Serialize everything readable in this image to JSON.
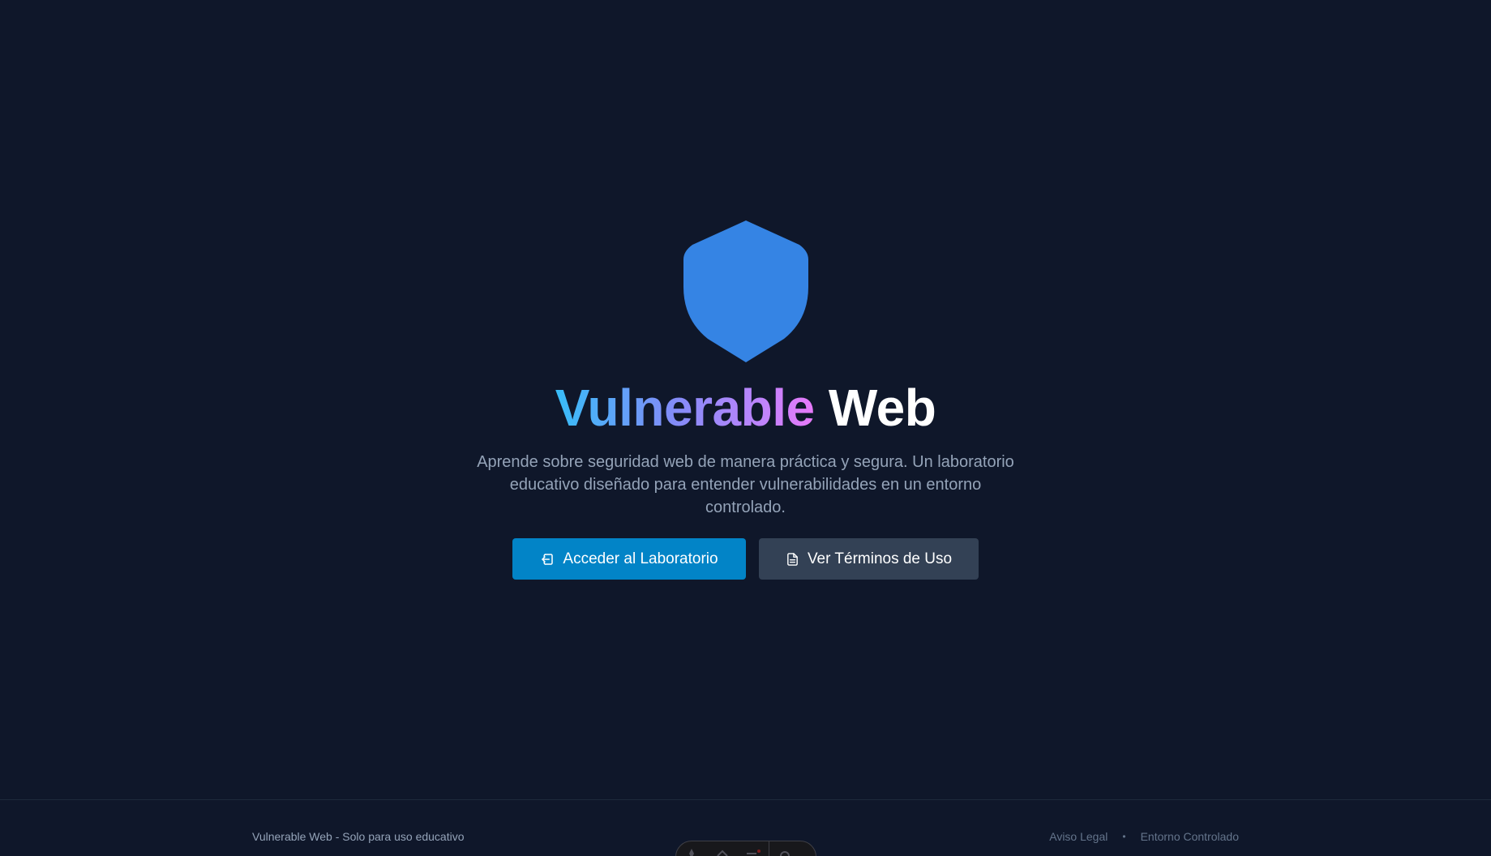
{
  "hero": {
    "title_gradient": "Vulnerable",
    "title_plain": "Web",
    "subtitle": "Aprende sobre seguridad web de manera práctica y segura. Un laboratorio educativo diseñado para entender vulnerabilidades en un entorno controlado.",
    "shield_icon": "shield-icon",
    "shield_color": "#3584e4"
  },
  "actions": {
    "primary_label": "Acceder al Laboratorio",
    "primary_icon": "login-icon",
    "primary_color": "#0284c7",
    "secondary_label": "Ver Términos de Uso",
    "secondary_icon": "document-icon",
    "secondary_color": "#334155"
  },
  "footer": {
    "left_text": "Vulnerable Web - Solo para uso educativo",
    "links": [
      "Aviso Legal",
      "Entorno Controlado"
    ],
    "separator": "•"
  },
  "colors": {
    "background": "#0f172a",
    "title_gradient": [
      "#38bdf8",
      "#818cf8",
      "#c084fc",
      "#e879f9"
    ]
  }
}
